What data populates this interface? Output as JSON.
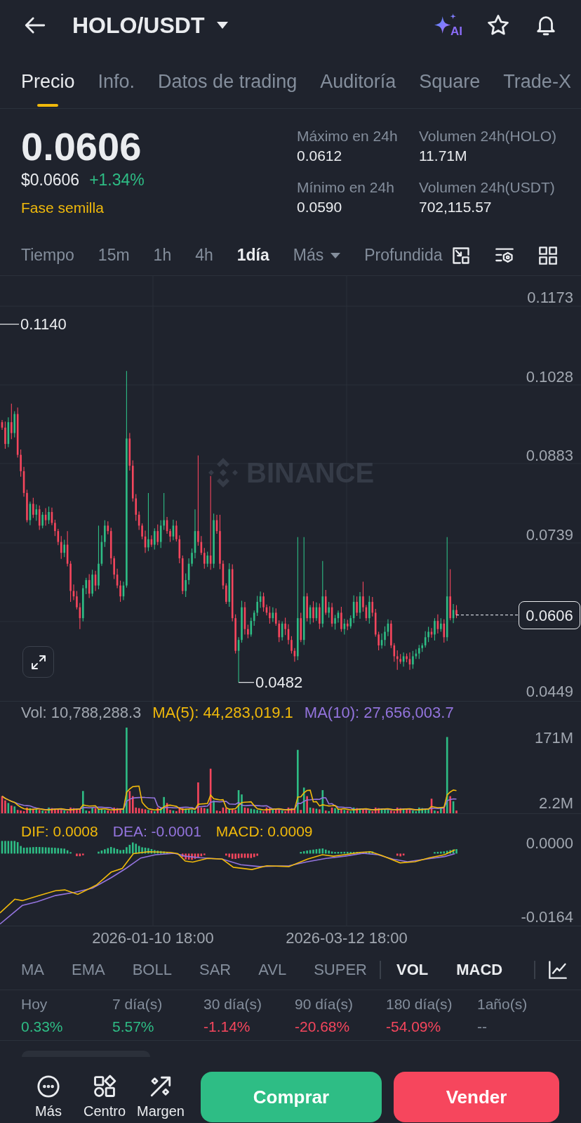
{
  "header": {
    "title": "HOLO/USDT",
    "ai_label": "AI"
  },
  "tabs": [
    {
      "label": "Precio",
      "selected": true
    },
    {
      "label": "Info.",
      "selected": false
    },
    {
      "label": "Datos de trading",
      "selected": false
    },
    {
      "label": "Auditoría",
      "selected": false
    },
    {
      "label": "Square",
      "selected": false
    },
    {
      "label": "Trade-X",
      "selected": false
    }
  ],
  "price": {
    "last": "0.0606",
    "usd": "$0.0606",
    "change": {
      "text": "+1.34%",
      "color": "#2ebd85"
    },
    "stage": "Fase semilla"
  },
  "stats": [
    {
      "label": "Máximo en 24h",
      "value": "0.0612"
    },
    {
      "label": "Volumen 24h(HOLO)",
      "value": "11.71M"
    },
    {
      "label": "Mínimo en 24h",
      "value": "0.0590"
    },
    {
      "label": "Volumen 24h(USDT)",
      "value": "702,115.57"
    }
  ],
  "intervals": [
    {
      "label": "Tiempo",
      "selected": false,
      "has_menu": false
    },
    {
      "label": "15m",
      "selected": false,
      "has_menu": false
    },
    {
      "label": "1h",
      "selected": false,
      "has_menu": false
    },
    {
      "label": "4h",
      "selected": false,
      "has_menu": false
    },
    {
      "label": "1día",
      "selected": true,
      "has_menu": false
    },
    {
      "label": "Más",
      "selected": false,
      "has_menu": true
    },
    {
      "label": "Profundida",
      "selected": false,
      "has_menu": false
    }
  ],
  "price_chart": {
    "watermark": "BINANCE",
    "axis_labels": [
      "0.1173",
      "0.1028",
      "0.0883",
      "0.0739",
      "0.0449"
    ],
    "high_label": "0.1140",
    "low_label": "0.0482",
    "last_price": "0.0606"
  },
  "volume": {
    "legend": [
      {
        "text": "Vol: 10,788,288.3",
        "color": "#a1a7b0"
      },
      {
        "text": "MA(5): 44,283,019.1",
        "color": "#f0b90b"
      },
      {
        "text": "MA(10): 27,656,003.7",
        "color": "#9474de"
      }
    ],
    "axis_labels": [
      "171M",
      "2.2M"
    ]
  },
  "macd": {
    "legend": [
      {
        "text": "DIF: 0.0008",
        "color": "#f0b90b"
      },
      {
        "text": "DEA: -0.0001",
        "color": "#9474de"
      },
      {
        "text": "MACD: 0.0009",
        "color": "#f0b90b"
      }
    ],
    "axis_labels": [
      "0.0000",
      "-0.0164"
    ]
  },
  "time_axis": [
    "2026-01-10 18:00",
    "2026-03-12 18:00"
  ],
  "indicators": {
    "main": [
      {
        "label": "MA",
        "selected": false
      },
      {
        "label": "EMA",
        "selected": false
      },
      {
        "label": "BOLL",
        "selected": false
      },
      {
        "label": "SAR",
        "selected": false
      },
      {
        "label": "AVL",
        "selected": false
      },
      {
        "label": "SUPER",
        "selected": false
      }
    ],
    "sub": [
      {
        "label": "VOL",
        "selected": true
      },
      {
        "label": "MACD",
        "selected": true
      }
    ]
  },
  "performance": [
    {
      "label": "Hoy",
      "value": "0.33%",
      "color": "#2ebd85"
    },
    {
      "label": "7 día(s)",
      "value": "5.57%",
      "color": "#2ebd85"
    },
    {
      "label": "30 día(s)",
      "value": "-1.14%",
      "color": "#f6465d"
    },
    {
      "label": "90 día(s)",
      "value": "-20.68%",
      "color": "#f6465d"
    },
    {
      "label": "180 día(s)",
      "value": "-54.09%",
      "color": "#f6465d"
    },
    {
      "label": "1año(s)",
      "value": "--",
      "color": "#848e9c"
    }
  ],
  "bottom_nav": [
    {
      "label": "Más"
    },
    {
      "label": "Centro"
    },
    {
      "label": "Margen"
    }
  ],
  "actions": [
    {
      "label": "Comprar",
      "kind": "buy"
    },
    {
      "label": "Vender",
      "kind": "sell"
    }
  ]
}
